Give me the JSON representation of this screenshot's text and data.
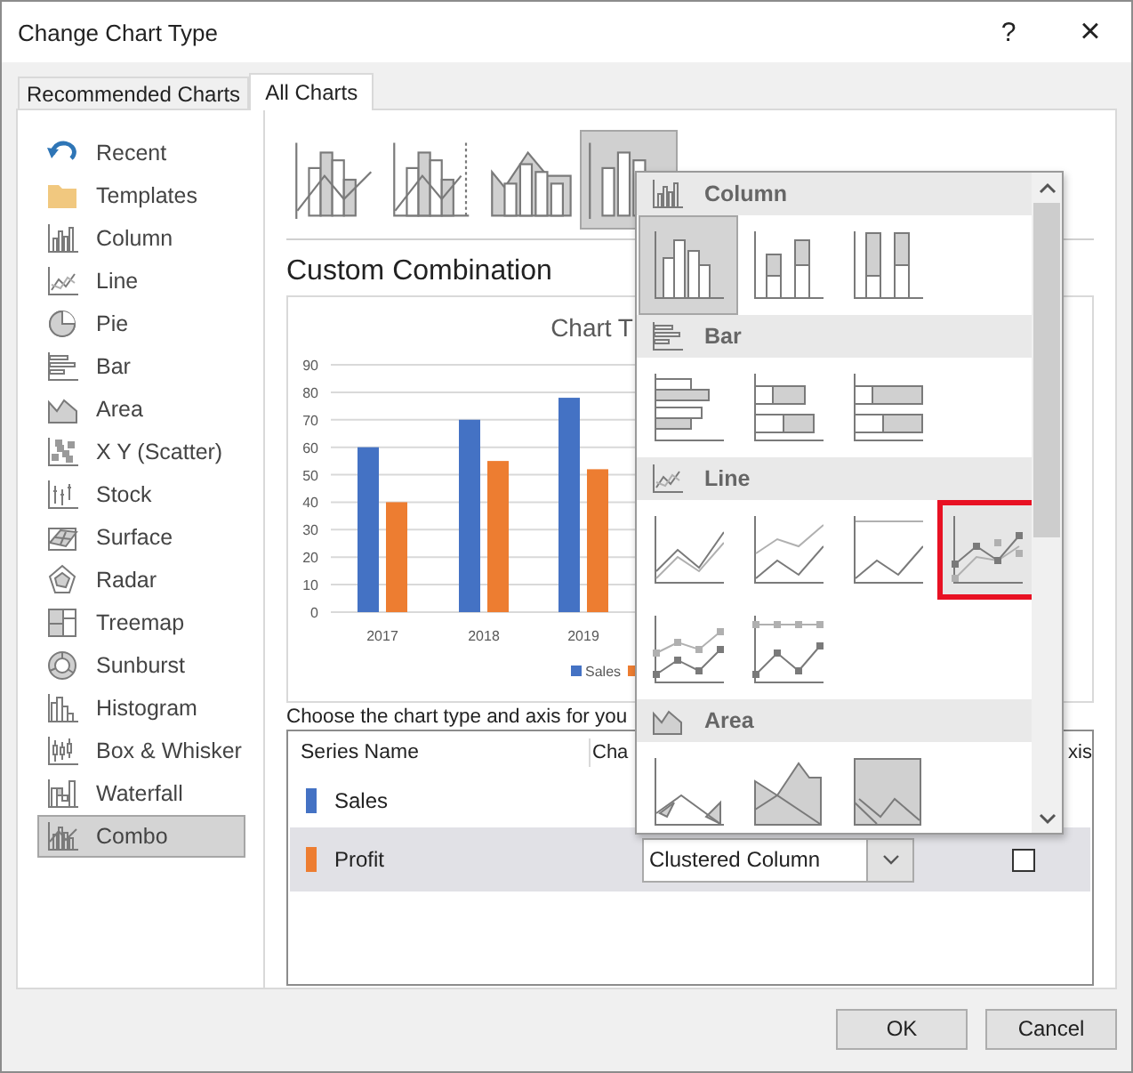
{
  "window": {
    "title": "Change Chart Type",
    "help": "?",
    "close": "×"
  },
  "tabs": [
    {
      "label": "Recommended Charts",
      "selected": false
    },
    {
      "label": "All Charts",
      "selected": true
    }
  ],
  "sidebar": {
    "items": [
      {
        "label": "Recent",
        "kind": "recent",
        "selected": false
      },
      {
        "label": "Templates",
        "kind": "templates",
        "selected": false
      },
      {
        "label": "Column",
        "kind": "column",
        "selected": false
      },
      {
        "label": "Line",
        "kind": "line",
        "selected": false
      },
      {
        "label": "Pie",
        "kind": "pie",
        "selected": false
      },
      {
        "label": "Bar",
        "kind": "bar",
        "selected": false
      },
      {
        "label": "Area",
        "kind": "area",
        "selected": false
      },
      {
        "label": "X Y (Scatter)",
        "kind": "scatter",
        "selected": false
      },
      {
        "label": "Stock",
        "kind": "stock",
        "selected": false
      },
      {
        "label": "Surface",
        "kind": "surface",
        "selected": false
      },
      {
        "label": "Radar",
        "kind": "radar",
        "selected": false
      },
      {
        "label": "Treemap",
        "kind": "treemap",
        "selected": false
      },
      {
        "label": "Sunburst",
        "kind": "sunburst",
        "selected": false
      },
      {
        "label": "Histogram",
        "kind": "histogram",
        "selected": false
      },
      {
        "label": "Box & Whisker",
        "kind": "boxwhisker",
        "selected": false
      },
      {
        "label": "Waterfall",
        "kind": "waterfall",
        "selected": false
      },
      {
        "label": "Combo",
        "kind": "combo",
        "selected": true
      }
    ]
  },
  "subtypes": [
    {
      "kind": "combo-line",
      "selected": false
    },
    {
      "kind": "combo-line-secondary",
      "selected": false
    },
    {
      "kind": "combo-area",
      "selected": false
    },
    {
      "kind": "combo-custom",
      "selected": true
    }
  ],
  "heading": "Custom Combination",
  "preview": {
    "chart_data": {
      "type": "bar",
      "title": "Chart T",
      "categories": [
        "2017",
        "2018",
        "2019"
      ],
      "series": [
        {
          "name": "Sales",
          "color": "#4472c4",
          "values": [
            60,
            70,
            78
          ]
        },
        {
          "color": "#ed7d31",
          "values": [
            40,
            55,
            52
          ]
        }
      ],
      "ylim": [
        0,
        90
      ],
      "grid": true,
      "yticks": [
        0,
        10,
        20,
        30,
        40,
        50,
        60,
        70,
        80,
        90
      ]
    }
  },
  "series_table": {
    "instruction": "Choose the chart type and axis for you",
    "columns": [
      "Series Name",
      "Cha",
      "xis"
    ],
    "rows": [
      {
        "name": "Sales",
        "color": "#4472c4"
      },
      {
        "name": "Profit",
        "color": "#ed7d31",
        "chart_type": "Clustered Column",
        "secondary_axis": false
      }
    ]
  },
  "dropdown": {
    "sections": [
      {
        "title": "Column",
        "kind": "column",
        "items": [
          {
            "kind": "column-clustered",
            "selected": true,
            "highlighted": false
          },
          {
            "kind": "column-stacked",
            "selected": false,
            "highlighted": false
          },
          {
            "kind": "column-100",
            "selected": false,
            "highlighted": false
          }
        ]
      },
      {
        "title": "Bar",
        "kind": "bar",
        "items": [
          {
            "kind": "bar-clustered",
            "selected": false,
            "highlighted": false
          },
          {
            "kind": "bar-stacked",
            "selected": false,
            "highlighted": false
          },
          {
            "kind": "bar-100",
            "selected": false,
            "highlighted": false
          }
        ]
      },
      {
        "title": "Line",
        "kind": "line",
        "items": [
          {
            "kind": "line",
            "selected": false,
            "highlighted": false
          },
          {
            "kind": "line-stacked",
            "selected": false,
            "highlighted": false
          },
          {
            "kind": "line-100",
            "selected": false,
            "highlighted": false
          },
          {
            "kind": "line-markers",
            "selected": false,
            "highlighted": true
          },
          {
            "kind": "line-stacked-markers",
            "selected": false,
            "highlighted": false
          },
          {
            "kind": "line-100-markers",
            "selected": false,
            "highlighted": false
          }
        ]
      },
      {
        "title": "Area",
        "kind": "area",
        "items": [
          {
            "kind": "area",
            "selected": false,
            "highlighted": false
          },
          {
            "kind": "area-stacked",
            "selected": false,
            "highlighted": false
          },
          {
            "kind": "area-100",
            "selected": false,
            "highlighted": false
          }
        ]
      }
    ]
  },
  "buttons": [
    {
      "label": "OK"
    },
    {
      "label": "Cancel"
    }
  ]
}
